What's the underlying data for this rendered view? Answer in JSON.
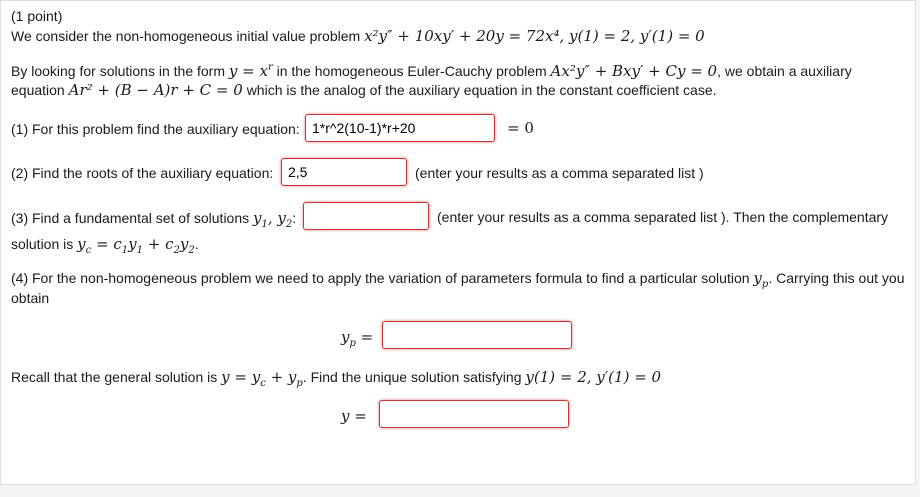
{
  "header": {
    "points": "(1 point)"
  },
  "problem": {
    "intro": "We consider the non-homogeneous initial value problem",
    "equation_text": "x²y″ + 10xy′ + 20y = 72x⁴,  y(1) = 2,  y′(1) = 0"
  },
  "paragraph": {
    "part1": "By looking for solutions in the form",
    "part2": "in the homogeneous Euler-Cauchy problem",
    "part3": ", we obtain a auxiliary",
    "part4": "equation",
    "part5": "which is the analog of the auxiliary equation in the constant coefficient case."
  },
  "q1": {
    "label": "(1) For this problem find the auxiliary equation:",
    "value": "1*r^2(10-1)*r+20",
    "suffix": "= 0"
  },
  "q2": {
    "label": "(2) Find the roots of the auxiliary equation:",
    "value": "2,5",
    "hint": "(enter your results as a comma separated list )"
  },
  "q3": {
    "label": "(3) Find a fundamental set of solutions",
    "value": "",
    "hint": "(enter your results as a comma separated list ). Then the complementary",
    "line2_prefix": "solution is"
  },
  "q4": {
    "text1": "(4) For the non-homogeneous problem we need to apply the variation of parameters formula to find a particular solution",
    "text1_end": ". Carrying this out you",
    "text2": "obtain",
    "yp_value": ""
  },
  "general": {
    "text1": "Recall that the general solution is",
    "text2": ". Find the unique solution satisfying",
    "y_value": ""
  },
  "colors": {
    "error_border": "#cc3333",
    "normal_border": "#c8c8c8"
  }
}
